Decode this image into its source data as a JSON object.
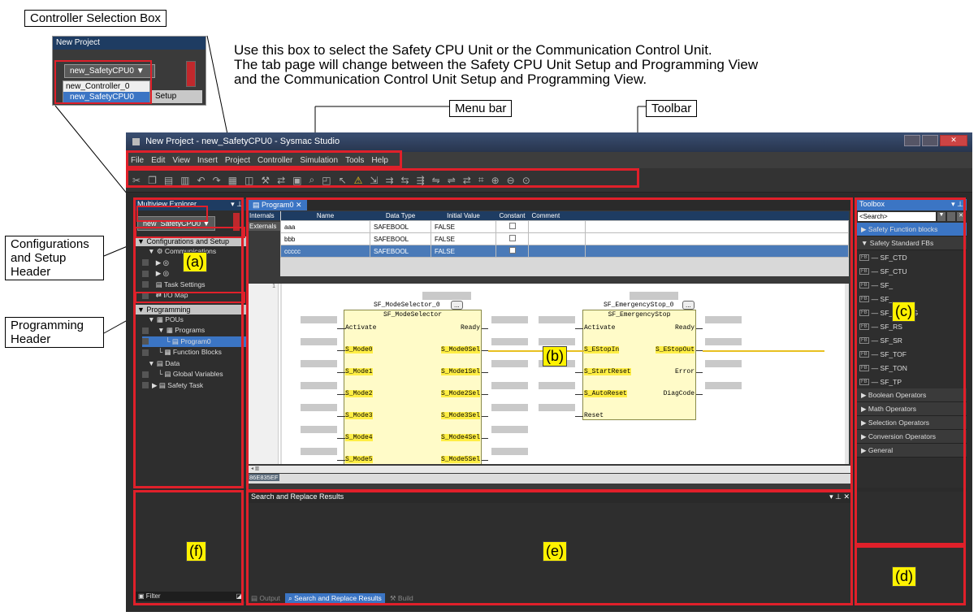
{
  "callouts": {
    "controller_box": "Controller Selection Box",
    "menu_bar": "Menu bar",
    "toolbar": "Toolbar",
    "config_header": "Configurations\nand Setup\nHeader",
    "prog_header": "Programming\nHeader"
  },
  "note": {
    "line1": "Use this box to select the Safety CPU Unit or the Communication Control Unit.",
    "line2": "The tab page will change between the Safety CPU Unit Setup and Programming View",
    "line3": "and the Communication Control Unit Setup and Programming View."
  },
  "markers": {
    "a": "(a)",
    "b": "(b)",
    "c": "(c)",
    "d": "(d)",
    "e": "(e)",
    "f": "(f)"
  },
  "inset": {
    "title": "New Project",
    "selected": "new_SafetyCPU0",
    "options": [
      "new_Controller_0",
      "new_SafetyCPU0"
    ],
    "setup": "Setup"
  },
  "window": {
    "title": "New Project - new_SafetyCPU0 - Sysmac Studio",
    "menus": [
      "File",
      "Edit",
      "View",
      "Insert",
      "Project",
      "Controller",
      "Simulation",
      "Tools",
      "Help"
    ]
  },
  "explorer": {
    "title": "Multiview Explorer",
    "controller": "new_SafetyCPU0",
    "config_header": "Configurations and Setup",
    "config_items": [
      "Communications",
      "Task Settings",
      "I/O Map"
    ],
    "prog_header": "Programming",
    "prog_items": [
      "POUs",
      "Programs",
      "Program0",
      "Function Blocks",
      "Data",
      "Global Variables",
      "Safety Task"
    ],
    "filter": "Filter"
  },
  "editor": {
    "tab": "Program0",
    "side_tabs": [
      "Internals",
      "Externals"
    ],
    "columns": [
      "Name",
      "Data Type",
      "Initial Value",
      "Constant",
      "Comment"
    ],
    "rows": [
      {
        "name": "aaa",
        "type": "SAFEBOOL",
        "init": "FALSE"
      },
      {
        "name": "bbb",
        "type": "SAFEBOOL",
        "init": "FALSE"
      },
      {
        "name": "ccccc",
        "type": "SAFEBOOL",
        "init": "FALSE"
      }
    ],
    "line_no": "1",
    "status_code": "86E835EF",
    "fb1": {
      "instance": "SF_ModeSelector_0",
      "type": "SF_ModeSelector",
      "inputs": [
        "Activate",
        "S_Mode0",
        "S_Mode1",
        "S_Mode2",
        "S_Mode3",
        "S_Mode4",
        "S_Mode5"
      ],
      "outputs": [
        "Ready",
        "S_Mode0Sel",
        "S_Mode1Sel",
        "S_Mode2Sel",
        "S_Mode3Sel",
        "S_Mode4Sel",
        "S_Mode5Sel"
      ]
    },
    "fb2": {
      "instance": "SF_EmergencyStop_0",
      "type": "SF_EmergencyStop",
      "inputs": [
        "Activate",
        "S_EStopIn",
        "S_StartReset",
        "S_AutoReset",
        "Reset"
      ],
      "outputs": [
        "Ready",
        "S_EStopOut",
        "Error",
        "DiagCode"
      ]
    },
    "dots": "..."
  },
  "toolbox": {
    "title": "Toolbox",
    "search": "<Search>",
    "groups_top": [
      "Safety Function blocks",
      "Safety Standard FBs"
    ],
    "fbs": [
      "SF_CTD",
      "SF_CTU",
      "SF_",
      "SF_",
      "SF_R_TRIG",
      "SF_RS",
      "SF_SR",
      "SF_TOF",
      "SF_TON",
      "SF_TP"
    ],
    "groups_bottom": [
      "Boolean Operators",
      "Math Operators",
      "Selection Operators",
      "Conversion Operators",
      "General"
    ],
    "fb_icon": "FB"
  },
  "output": {
    "title": "Search and Replace Results",
    "tabs": [
      "Output",
      "Search and Replace Results",
      "Build"
    ]
  }
}
